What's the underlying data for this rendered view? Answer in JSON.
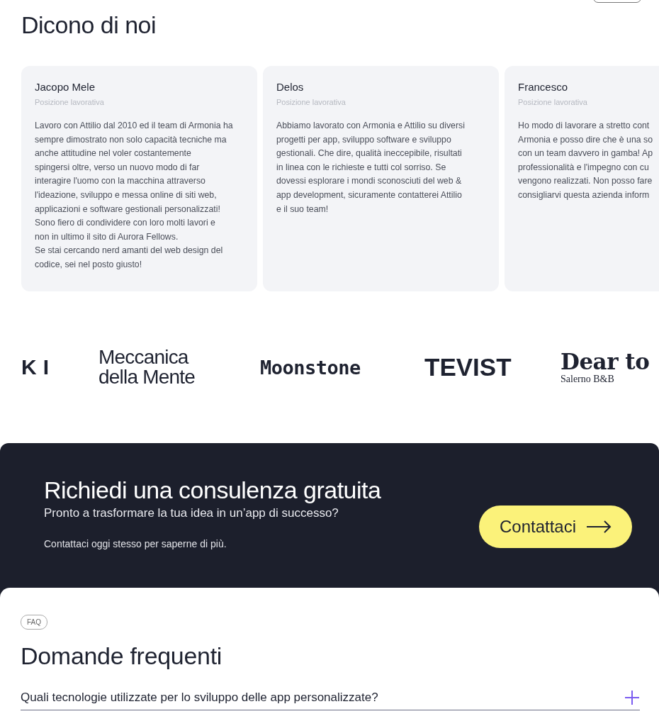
{
  "testimonials": {
    "title": "Dicono di noi",
    "cards": [
      {
        "name": "Jacopo Mele",
        "role": "Posizione lavorativa",
        "text": "Lavoro con Attilio dal 2010 ed il team di Armonia ha\nsempre dimostrato non solo capacità tecniche ma\nanche attitudine nel voler costantemente\nspingersi oltre, verso un nuovo modo di far\ninteragire l'uomo con la macchina attraverso\nl'ideazione, sviluppo e messa online di siti web,\napplicazioni e software gestionali personalizzati!\nSono fiero di condividere con loro molti lavori e\nnon in ultimo il sito di Aurora Fellows.\nSe stai cercando nerd amanti del web design del\ncodice, sei nel posto giusto!"
      },
      {
        "name": "Delos",
        "role": "Posizione lavorativa",
        "text": "Abbiamo lavorato con Armonia e Attilio su diversi\nprogetti per app, sviluppo software e sviluppo\ngestionali. Che dire, qualità ineccepibile, risultati\nin linea con le richieste e tutti col sorriso. Se\ndovessi esplorare i mondi sconosciuti del web &\napp development, sicuramente contatterei Attilio\ne il suo team!"
      },
      {
        "name": "Francesco",
        "role": "Posizione lavorativa",
        "text": "Ho modo di lavorare a stretto cont\nArmonia e posso dire che è una so\ncon un team davvero in gamba! Ap\nprofessionalità e l'impegno con cu\nvengono realizzati. Non posso fare\nconsigliarvi questa azienda inform"
      }
    ]
  },
  "logos": [
    {
      "kind": "spaced",
      "text": "KI"
    },
    {
      "kind": "stacked",
      "text": "Meccanica\ndella Mente"
    },
    {
      "kind": "mono",
      "text": "Moonstone"
    },
    {
      "kind": "heavy",
      "text": "TEVIST"
    },
    {
      "kind": "serif",
      "text": "Dear to",
      "subtitle": "Salerno B&B"
    }
  ],
  "cta": {
    "title": "Richiedi una consulenza gratuita",
    "subtitle": "Pronto a trasformare la tua idea in un’app di successo?",
    "note": "Contattaci oggi stesso per saperne di più.",
    "button": "Contattaci"
  },
  "faq": {
    "tag": "FAQ",
    "title": "Domande frequenti",
    "items": [
      {
        "question": "Quali tecnologie utilizzate per lo sviluppo delle app personalizzate?",
        "expanded": false
      }
    ]
  }
}
